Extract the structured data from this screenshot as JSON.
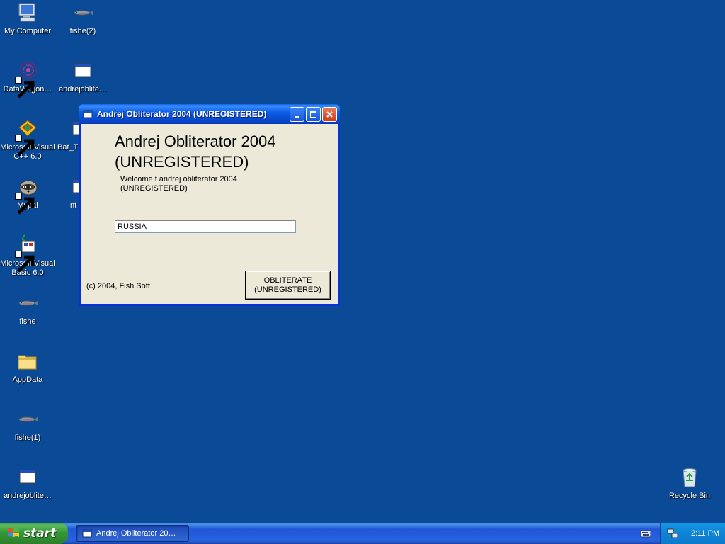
{
  "desktop": {
    "icons": [
      {
        "label": "My Computer",
        "icon": "my-computer-icon"
      },
      {
        "label": "fishe(2)",
        "icon": "fish-icon"
      },
      {
        "label": "DataWagon…",
        "icon": "datawagon-icon"
      },
      {
        "label": "andrejoblite…",
        "icon": "application-icon"
      },
      {
        "label": "Microsoft Visual C++ 6.0",
        "icon": "visual-cpp-icon"
      },
      {
        "label": "Bat_T",
        "icon": "application-icon"
      },
      {
        "label": "Mypal",
        "icon": "mypal-raccoon-icon"
      },
      {
        "label": "nt",
        "icon": "application-icon"
      },
      {
        "label": "Microsoft Visual Basic 6.0",
        "icon": "visual-basic-icon"
      },
      {
        "label": "fishe",
        "icon": "fish-icon"
      },
      {
        "label": "AppData",
        "icon": "folder-icon"
      },
      {
        "label": "fishe(1)",
        "icon": "fish-icon"
      },
      {
        "label": "andrejoblite…",
        "icon": "application-icon"
      },
      {
        "label": "Recycle Bin",
        "icon": "recycle-bin-icon"
      }
    ]
  },
  "window": {
    "title": "Andrej Obliterator 2004 (UNREGISTERED)",
    "heading": "Andrej Obliterator 2004 (UNREGISTERED)",
    "welcome_text": "Welcome t andrej obliterator 2004 (UNREGISTERED)",
    "input_value": "RUSSIA",
    "copyright": "(c) 2004, Fish Soft",
    "button_label": "OBLITERATE\n(UNREGISTERED)"
  },
  "taskbar": {
    "start_label": "start",
    "task_item_label": "Andrej Obliterator 20…",
    "clock": "2:11 PM"
  },
  "colors": {
    "desktop_bg": "#0a4a97",
    "titlebar_blue": "#0a5fe8",
    "window_face": "#ece9d8",
    "start_green": "#369836"
  }
}
